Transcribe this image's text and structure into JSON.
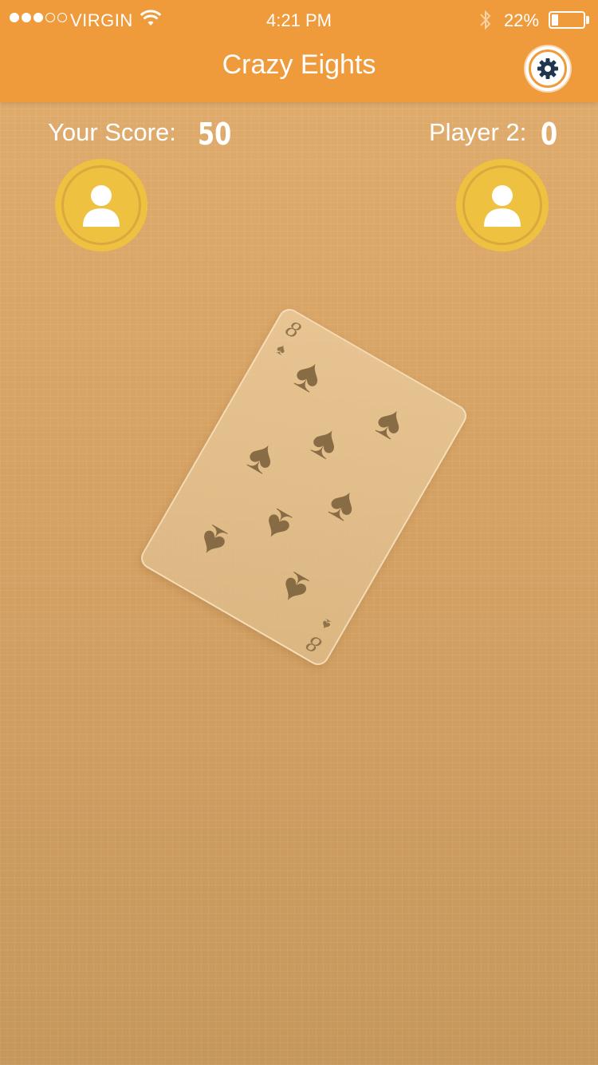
{
  "status_bar": {
    "carrier": "VIRGIN",
    "time": "4:21 PM",
    "battery_percent": "22%",
    "signal_bars_filled": 3,
    "signal_bars_total": 5
  },
  "header": {
    "title": "Crazy Eights",
    "settings_icon": "gear-icon"
  },
  "players": [
    {
      "label": "Your Score:",
      "score": "50",
      "avatar_icon": "user-icon"
    },
    {
      "label": "Player 2:",
      "score": "0",
      "avatar_icon": "user-icon"
    }
  ],
  "card": {
    "rank": "8",
    "suit": "♠",
    "pip_count": 8
  },
  "colors": {
    "header": "#ef9b3c",
    "avatar": "#efc140",
    "table": "#d7a364"
  }
}
